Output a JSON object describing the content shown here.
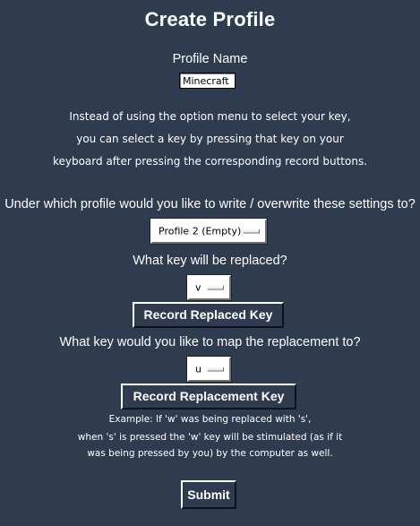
{
  "title": "Create Profile",
  "profile_name": {
    "label": "Profile Name",
    "value": "Minecraft"
  },
  "instructions": [
    "Instead of using the option menu to select your key,",
    "you can select a key by pressing that key on your",
    "keyboard after pressing the corresponding record buttons."
  ],
  "profile_question": "Under which profile would you like to write / overwrite these settings to?",
  "profile_select": {
    "selected": "Profile 2 (Empty)"
  },
  "replaced_key": {
    "question": "What key will be replaced?",
    "selected": "v",
    "record_label": "Record Replaced Key"
  },
  "replacement_key": {
    "question": "What key would you like to map the replacement to?",
    "selected": "u",
    "record_label": "Record Replacement Key"
  },
  "example": [
    "Example: If 'w' was being replaced with 's',",
    "when 's' is pressed the 'w' key will be stimulated (as if it",
    "was being pressed by you) by the computer as well."
  ],
  "submit_label": "Submit",
  "colors": {
    "background": "#2f3c4f",
    "text": "#ffffff"
  }
}
